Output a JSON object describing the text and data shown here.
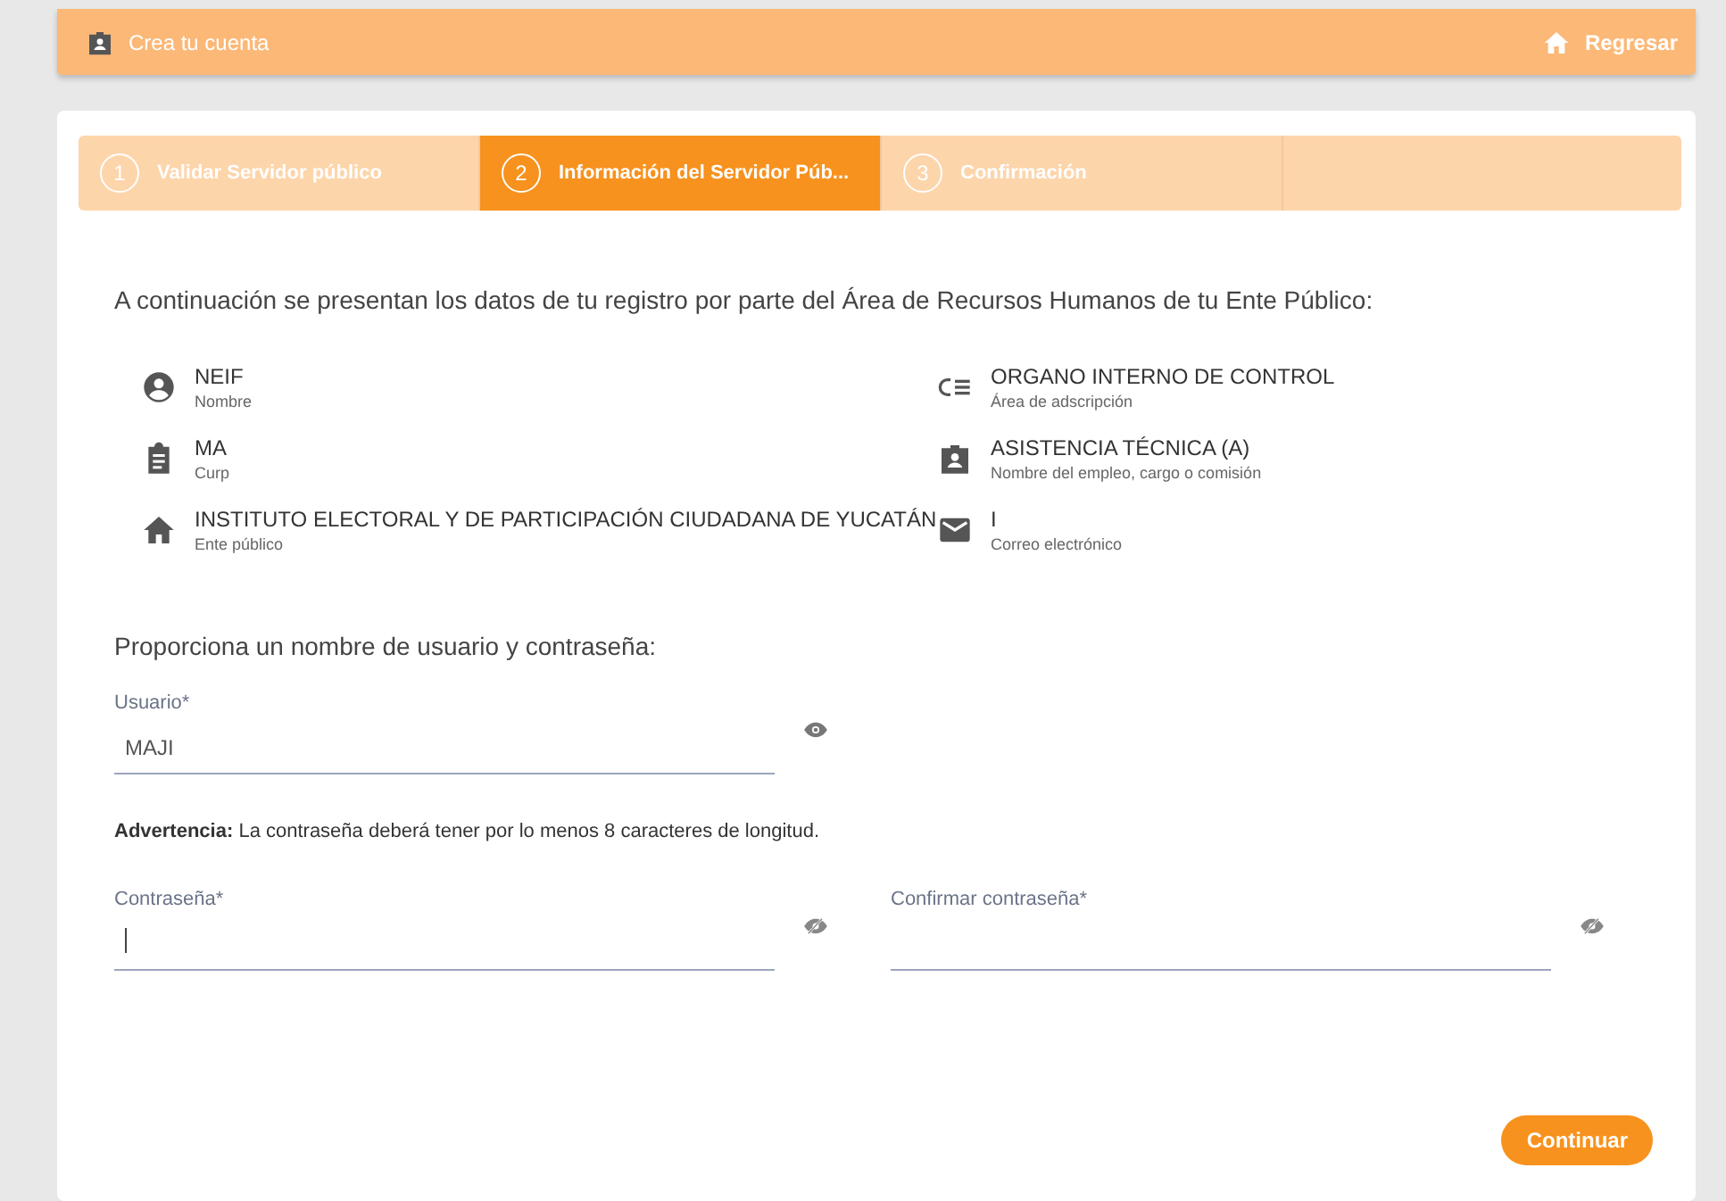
{
  "header": {
    "title": "Crea tu cuenta",
    "back_label": "Regresar"
  },
  "steps": [
    {
      "number": "1",
      "label": "Validar Servidor público",
      "selected": false
    },
    {
      "number": "2",
      "label": "Información del Servidor Púb...",
      "selected": true
    },
    {
      "number": "3",
      "label": "Confirmación",
      "selected": false
    }
  ],
  "intro": "A continuación se presentan los datos de tu registro por parte del Área de Recursos Humanos de tu Ente Público:",
  "info_columns": [
    [
      {
        "kind": "person",
        "value": "NEIF",
        "label": "Nombre"
      },
      {
        "kind": "clipboard",
        "value": "MA",
        "label": "Curp"
      },
      {
        "kind": "home",
        "value": "INSTITUTO ELECTORAL Y DE PARTICIPACIÓN CIUDADANA DE YUCATÁN",
        "label": "Ente público"
      }
    ],
    [
      {
        "kind": "list",
        "value": "ORGANO INTERNO DE CONTROL",
        "label": "Área de adscripción"
      },
      {
        "kind": "badge",
        "value": "ASISTENCIA TÉCNICA (A)",
        "label": "Nombre del empleo, cargo o comisión"
      },
      {
        "kind": "mail",
        "value": "I",
        "label": "Correo electrónico"
      }
    ]
  ],
  "credentials_prompt": "Proporciona un nombre de usuario y contraseña:",
  "username": {
    "label": "Usuario*",
    "value": "MAJI",
    "visible": true
  },
  "warning": "**Advertencia:** La contraseña deberá tener por lo menos 8 caracteres de longitud.",
  "password_fields": [
    {
      "label": "Contraseña*",
      "visible": false,
      "focused": true
    },
    {
      "label": "Confirmar contraseña*",
      "visible": false
    }
  ],
  "continue_button": "Continuar"
}
